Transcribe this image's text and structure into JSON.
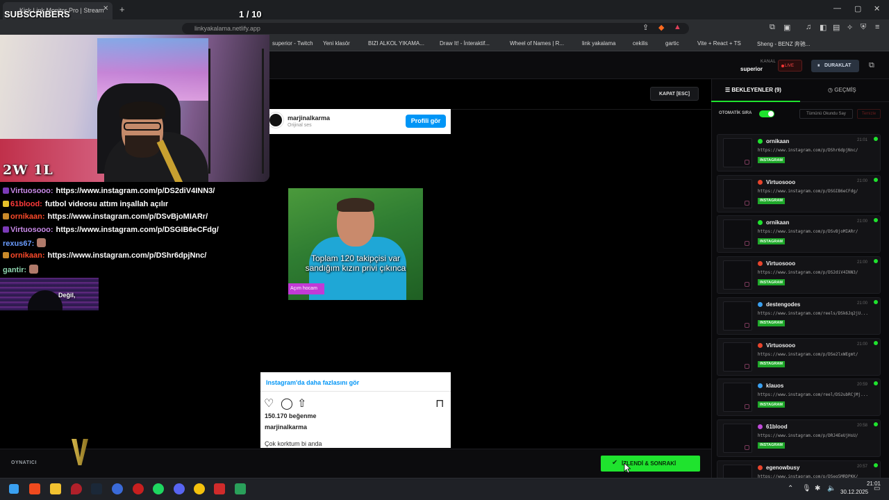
{
  "browser": {
    "tab_title": "Kick Link Monitor Pro | Stream",
    "tab_close": "✕",
    "new_tab": "+",
    "url": "linkyakalama.netlify.app",
    "bookmarks": [
      "superior - Twitch",
      "Yeni klasör",
      "BIZI ALKOL YIKAMA...",
      "Draw It! - İnteraktif...",
      "Wheel of Names | R...",
      "link yakalama",
      "cekilis",
      "gartic",
      "Vite + React + TS",
      "Sheng - BENZ 奔驰..."
    ]
  },
  "header": {
    "kanal_label": "KANAL",
    "kanal_value": "superior",
    "live_label": "LIVE",
    "pause_label": "DURAKLAT"
  },
  "player": {
    "close_label": "KAPAT [ESC]",
    "player_label": "OYNATICI",
    "next_label": "İZLENDİ & SONRAKİ"
  },
  "instagram": {
    "username": "marjinalkarma",
    "sub": "Orijinal ses",
    "profile_button": "Profili gör",
    "video_caption": "Toplam 120 takipçisi var sandığım kızın privi çıkınca",
    "video_tag": "Açım hocam",
    "more_link": "Instagram'da daha fazlasını gör",
    "likes": "150.170 beğenme",
    "owner": "marjinalkarma",
    "caption": "Çok korktum bi anda"
  },
  "sidebar": {
    "tab_waiting": "BEKLEYENLER (9)",
    "tab_history": "GEÇMİŞ",
    "auto_queue_label": "OTOMATİK SIRA",
    "auto_queue_on": true,
    "mark_all": "Tümünü Okundu Say",
    "clear": "Temizle",
    "items": [
      {
        "user": "ornikaan",
        "time": "21:01",
        "url": "https://www.instagram.com/p/DShr6dpjNnc/",
        "platform": "INSTAGRAM",
        "badge_color": "#1fe32e"
      },
      {
        "user": "Virtuosooo",
        "time": "21:00",
        "url": "https://www.instagram.com/p/DSGIB6eCFdg/",
        "platform": "INSTAGRAM",
        "badge_color": "#e8442c"
      },
      {
        "user": "ornikaan",
        "time": "21:00",
        "url": "https://www.instagram.com/p/DSvBjoMIARr/",
        "platform": "INSTAGRAM",
        "badge_color": "#1fe32e"
      },
      {
        "user": "Virtuosooo",
        "time": "21:00",
        "url": "https://www.instagram.com/p/DS2diV4INN3/",
        "platform": "INSTAGRAM",
        "badge_color": "#e8442c"
      },
      {
        "user": "destengodes",
        "time": "21:00",
        "url": "https://www.instagram.com/reels/DSk6Jq2jU...",
        "platform": "INSTAGRAM",
        "badge_color": "#3aa0f0"
      },
      {
        "user": "Virtuosooo",
        "time": "21:00",
        "url": "https://www.instagram.com/p/DSe2lxWEgmt/",
        "platform": "INSTAGRAM",
        "badge_color": "#e8442c"
      },
      {
        "user": "klauos",
        "time": "20:59",
        "url": "https://www.instagram.com/reel/DS2ubRCjMj...",
        "platform": "INSTAGRAM",
        "badge_color": "#3aa0f0"
      },
      {
        "user": "61blood",
        "time": "20:58",
        "url": "https://www.instagram.com/p/DRJ4EeUjHsU/",
        "platform": "INSTAGRAM",
        "badge_color": "#c04ad8"
      },
      {
        "user": "egenowbusy",
        "time": "20:57",
        "url": "https://www.instagram.com/p/DSeg5MRDPKK/",
        "platform": "INSTAGRAM",
        "badge_color": "#e8442c"
      }
    ]
  },
  "overlay": {
    "subscribers": "SUBSCRIBERS",
    "pager": "1  / 10",
    "score": "2W 1L",
    "alert_text": "Değil,",
    "chat": [
      {
        "user": "Virtuosooo:",
        "msg": "https://www.instagram.com/p/DS2diV4INN3/",
        "color": "#c98ae8",
        "icon_color": "#7b3ab8"
      },
      {
        "user": "61blood:",
        "msg": "futbol videosu attım inşallah açılır",
        "color": "#ff3a3a",
        "icon_color": "#e6c12a"
      },
      {
        "user": "ornikaan:",
        "msg": "https://www.instagram.com/p/DSvBjoMIARr/",
        "color": "#ff4a2a",
        "icon_color": "#c98a2a"
      },
      {
        "user": "Virtuosooo:",
        "msg": "https://www.instagram.com/p/DSGIB6eCFdg/",
        "color": "#c98ae8",
        "icon_color": "#7b3ab8"
      },
      {
        "user": "rexus67:",
        "msg": "",
        "color": "#6a9cff",
        "icon_color": ""
      },
      {
        "user": "ornikaan:",
        "msg": "https://www.instagram.com/p/DShr6dpjNnc/",
        "color": "#ff4a2a",
        "icon_color": "#c98a2a"
      },
      {
        "user": "gantir:",
        "msg": "",
        "color": "#8fd6b0",
        "icon_color": ""
      }
    ]
  },
  "taskbar": {
    "time": "21:01",
    "date": "30.12.2025"
  }
}
